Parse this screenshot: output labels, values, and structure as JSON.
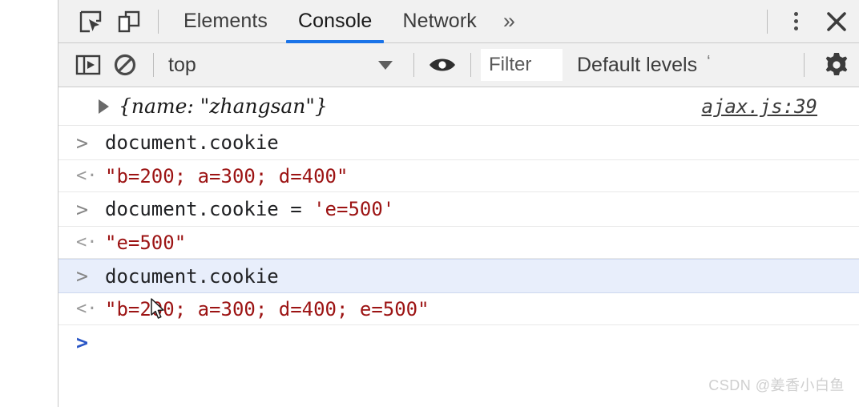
{
  "devtools": {
    "tabs": [
      {
        "label": "Elements",
        "active": false
      },
      {
        "label": "Console",
        "active": true
      },
      {
        "label": "Network",
        "active": false
      }
    ],
    "more_tabs_label": "»",
    "inspect_icon": "inspect-element-icon",
    "device_icon": "device-toolbar-icon",
    "kebab_label": "more-options",
    "close_label": "×"
  },
  "filterbar": {
    "sidebar_toggle_icon": "console-sidebar-icon",
    "clear_icon": "clear-console-icon",
    "context": "top",
    "context_caret": "▼",
    "eye_icon": "live-expression-icon",
    "filter_placeholder": "Filter",
    "filter_value": "Filter",
    "levels_label": "Default levels",
    "levels_caret": "‘",
    "settings_icon": "settings-gear-icon"
  },
  "console": {
    "entries": [
      {
        "kind": "log",
        "gutter": "",
        "expandable": true,
        "object_prefix": "{name: ",
        "object_value": "\"zhangsan\"",
        "object_suffix": "}",
        "source": "ajax.js:39",
        "selected": false
      },
      {
        "kind": "input",
        "gutter": ">",
        "code": "document.cookie",
        "code_literal": "",
        "selected": false
      },
      {
        "kind": "output",
        "gutter": "<·",
        "value": "\"b=200; a=300; d=400\"",
        "selected": false
      },
      {
        "kind": "input",
        "gutter": ">",
        "code": "document.cookie = ",
        "code_literal": "'e=500'",
        "selected": false
      },
      {
        "kind": "output",
        "gutter": "<·",
        "value": "\"e=500\"",
        "selected": false
      },
      {
        "kind": "input",
        "gutter": ">",
        "code": "document.cookie",
        "code_literal": "",
        "selected": true
      },
      {
        "kind": "output",
        "gutter": "<·",
        "value": "\"b=200; a=300; d=400; e=500\"",
        "selected": false
      },
      {
        "kind": "prompt",
        "gutter": ">",
        "code": "",
        "code_literal": "",
        "selected": false
      }
    ]
  },
  "watermark": "CSDN @姜香小白鱼",
  "colors": {
    "accent": "#1a73e8",
    "string": "#9c1313",
    "selected_row": "#e8eefb",
    "toolbar_bg": "#f1f1f1"
  }
}
